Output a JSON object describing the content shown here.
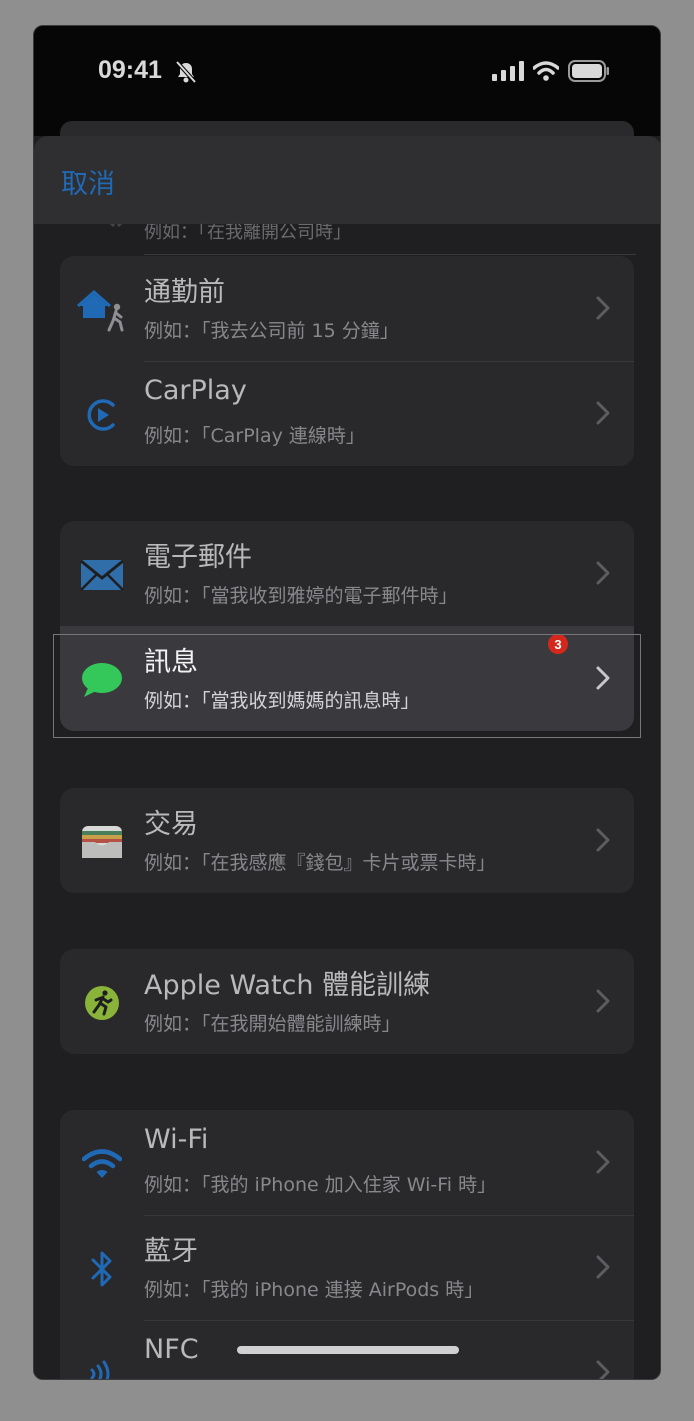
{
  "status": {
    "time": "09:41"
  },
  "nav": {
    "cancel_label": "取消"
  },
  "peek": {
    "subtitle": "例如：「在我離開公司時」"
  },
  "groups": [
    {
      "items": [
        {
          "title": "通勤前",
          "subtitle": "例如：「我去公司前 15 分鐘」",
          "icon": "home-walk-icon"
        },
        {
          "title": "CarPlay",
          "subtitle": "例如：「CarPlay 連線時」",
          "icon": "carplay-icon"
        }
      ]
    },
    {
      "items": [
        {
          "title": "電子郵件",
          "subtitle": "例如：「當我收到雅婷的電子郵件時」",
          "icon": "mail-icon"
        },
        {
          "title": "訊息",
          "subtitle": "例如：「當我收到媽媽的訊息時」",
          "icon": "messages-icon",
          "badge": "3"
        }
      ]
    },
    {
      "items": [
        {
          "title": "交易",
          "subtitle": "例如：「在我感應『錢包』卡片或票卡時」",
          "icon": "wallet-icon"
        }
      ]
    },
    {
      "items": [
        {
          "title": "Apple Watch 體能訓練",
          "subtitle": "例如：「在我開始體能訓練時」",
          "icon": "workout-icon"
        }
      ]
    },
    {
      "items": [
        {
          "title": "Wi-Fi",
          "subtitle": "例如：「我的 iPhone 加入住家 Wi-Fi 時」",
          "icon": "wifi-icon"
        },
        {
          "title": "藍牙",
          "subtitle": "例如：「我的 iPhone 連接 AirPods 時」",
          "icon": "bluetooth-icon"
        },
        {
          "title": "NFC",
          "subtitle": "",
          "icon": "nfc-icon"
        }
      ]
    }
  ],
  "colors": {
    "accent": "#1f69b5",
    "badge": "#d4281c",
    "messages_green": "#34c759"
  }
}
